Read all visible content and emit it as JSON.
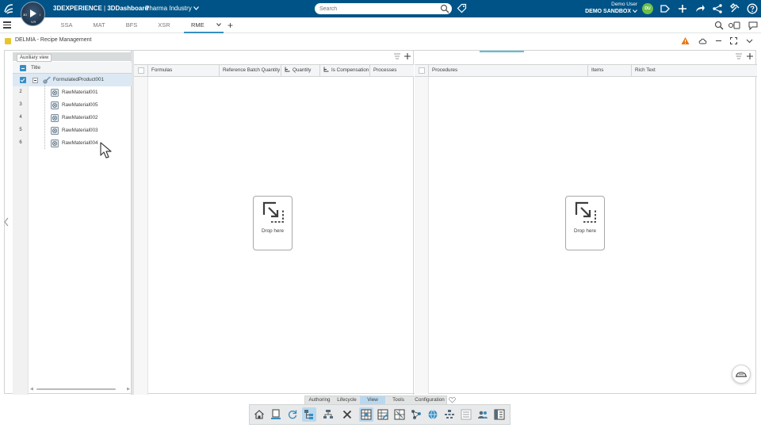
{
  "topbar": {
    "brand": "3DEXPERIENCE",
    "separator": " | ",
    "dashboard": "3DDashboard",
    "context": "Pharma Industry",
    "search_placeholder": "Search",
    "user_name": "Demo User",
    "tenant": "DEMO SANDBOX",
    "avatar_initials": "DU",
    "compass": {
      "left": "3D",
      "center": "V.R",
      "right": "i"
    }
  },
  "tabs": [
    {
      "label": "SSA",
      "active": false
    },
    {
      "label": "MAT",
      "active": false
    },
    {
      "label": "BFS",
      "active": false
    },
    {
      "label": "XSR",
      "active": false
    },
    {
      "label": "RME",
      "active": true
    }
  ],
  "app": {
    "name": "DELMIA - Recipe Management"
  },
  "tree": {
    "view_tab": "Auxiliary view",
    "header": "Title",
    "rows": [
      {
        "num": "",
        "label": "FormulatedProduct001",
        "selected": true
      },
      {
        "num": "2",
        "label": "RawMaterial001"
      },
      {
        "num": "3",
        "label": "RawMaterial005"
      },
      {
        "num": "4",
        "label": "RawMaterial002"
      },
      {
        "num": "5",
        "label": "RawMaterial003"
      },
      {
        "num": "6",
        "label": "RawMaterial004"
      }
    ]
  },
  "formulas": {
    "columns": [
      "Formulas",
      "Reference Batch Quantity",
      "Quantity",
      "Is Compensation",
      "Processes"
    ],
    "drop_label": "Drop here"
  },
  "procedures": {
    "columns": [
      "Procedures",
      "Items",
      "Rich Text"
    ],
    "drop_label": "Drop here"
  },
  "actionbar": {
    "tabs": [
      {
        "label": "Authoring",
        "active": false
      },
      {
        "label": "Lifecycle",
        "active": false
      },
      {
        "label": "View",
        "active": true
      },
      {
        "label": "Tools",
        "active": false
      },
      {
        "label": "Configuration",
        "active": false
      }
    ],
    "icons": [
      "home-icon",
      "document-stack-icon",
      "refresh-icon",
      "tree-view-icon",
      "structure-icon",
      "close-icon",
      "grid-view-icon",
      "grid-edit-icon",
      "tile-view-icon",
      "network-icon",
      "globe-icon",
      "hierarchy-icon",
      "list-view-icon",
      "users-icon",
      "properties-panel-icon"
    ]
  },
  "colors": {
    "topbar": "#005386",
    "accent": "#368ec4",
    "selected_row": "#dce9f4",
    "warning": "#e87511",
    "app_badge": "#e8c52e"
  }
}
